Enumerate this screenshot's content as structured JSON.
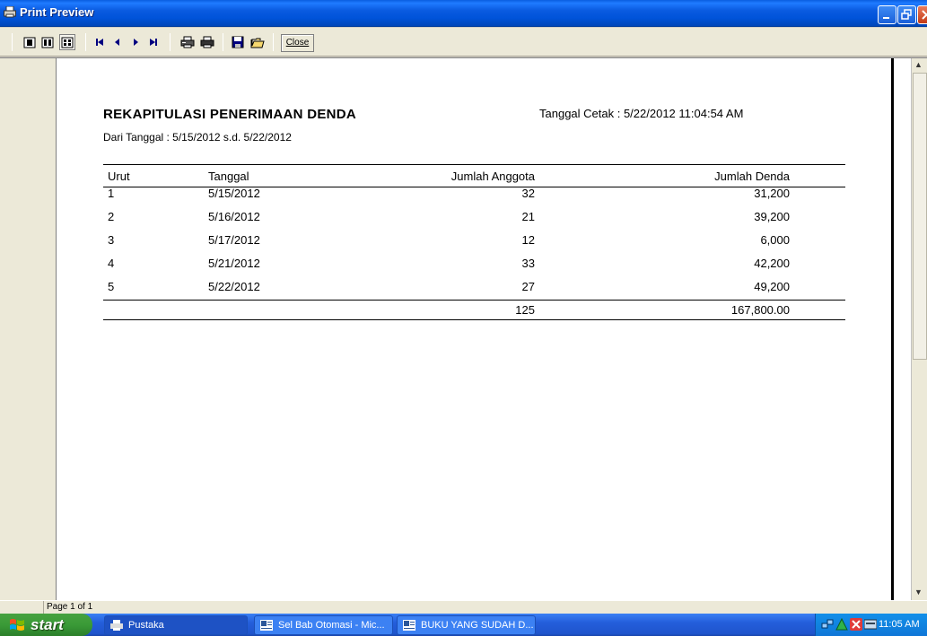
{
  "window": {
    "title": "Print Preview"
  },
  "toolbar": {
    "icons": [
      "one-page-icon",
      "two-page-icon",
      "multi-page-icon",
      "first-page-icon",
      "prev-page-icon",
      "next-page-icon",
      "last-page-icon",
      "print-setup-icon",
      "print-icon",
      "save-icon",
      "open-icon"
    ],
    "close_label": "Close"
  },
  "report": {
    "title": "REKAPITULASI PENERIMAAN DENDA",
    "print_date": "Tanggal Cetak : 5/22/2012 11:04:54 AM",
    "date_range": "Dari Tanggal : 5/15/2012 s.d. 5/22/2012",
    "columns": [
      "Urut",
      "Tanggal",
      "Jumlah Anggota",
      "Jumlah Denda"
    ],
    "rows": [
      {
        "urut": "1",
        "tanggal": "5/15/2012",
        "anggota": "32",
        "denda": "31,200"
      },
      {
        "urut": "2",
        "tanggal": "5/16/2012",
        "anggota": "21",
        "denda": "39,200"
      },
      {
        "urut": "3",
        "tanggal": "5/17/2012",
        "anggota": "12",
        "denda": "6,000"
      },
      {
        "urut": "4",
        "tanggal": "5/21/2012",
        "anggota": "33",
        "denda": "42,200"
      },
      {
        "urut": "5",
        "tanggal": "5/22/2012",
        "anggota": "27",
        "denda": "49,200"
      }
    ],
    "totals": {
      "anggota": "125",
      "denda": "167,800.00"
    }
  },
  "status": {
    "page": "Page 1 of 1"
  },
  "taskbar": {
    "start_label": "start",
    "tasks": [
      {
        "label": "Pustaka"
      },
      {
        "label": "Sel Bab Otomasi - Mic..."
      },
      {
        "label": "BUKU YANG SUDAH D..."
      }
    ],
    "clock": "11:05 AM"
  },
  "colors": {
    "titlebar": "#0a5be0",
    "taskbar": "#245edb",
    "start": "#3a9a37",
    "tray": "#1290e9"
  }
}
